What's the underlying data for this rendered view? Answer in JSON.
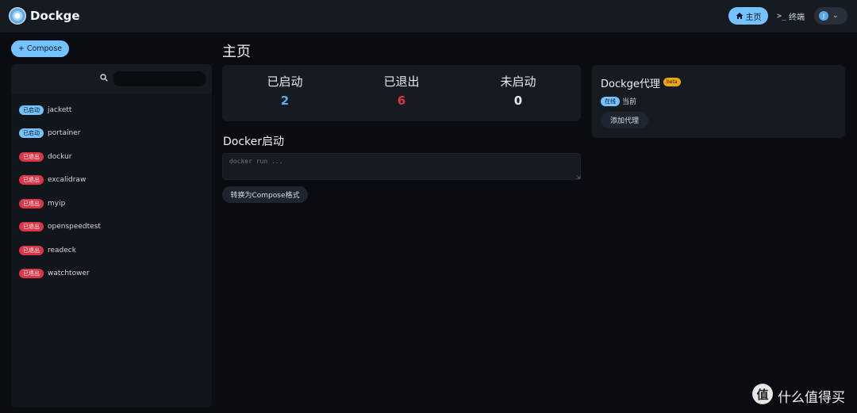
{
  "header": {
    "brand": "Dockge",
    "nav_home": "主页",
    "nav_terminal": "终端",
    "avatar_initial": "J"
  },
  "sidebar": {
    "compose_label": "Compose",
    "search_value": "",
    "stacks": [
      {
        "status": "已启动",
        "state": "running",
        "name": "jackett"
      },
      {
        "status": "已启动",
        "state": "running",
        "name": "portainer"
      },
      {
        "status": "已退出",
        "state": "exited",
        "name": "dockur"
      },
      {
        "status": "已退出",
        "state": "exited",
        "name": "excalidraw"
      },
      {
        "status": "已退出",
        "state": "exited",
        "name": "myip"
      },
      {
        "status": "已退出",
        "state": "exited",
        "name": "openspeedtest"
      },
      {
        "status": "已退出",
        "state": "exited",
        "name": "readeck"
      },
      {
        "status": "已退出",
        "state": "exited",
        "name": "watchtower"
      }
    ]
  },
  "main": {
    "title": "主页",
    "stats": [
      {
        "label": "已启动",
        "value": "2",
        "color": "#5aaaf0"
      },
      {
        "label": "已退出",
        "value": "6",
        "color": "#dc3545"
      },
      {
        "label": "未启动",
        "value": "0",
        "color": "#e6e9ed"
      }
    ],
    "docker_run_title": "Docker启动",
    "docker_run_placeholder": "docker run ...",
    "convert_label": "转换为Compose格式"
  },
  "proxy": {
    "title": "Dockge代理",
    "beta": "beta",
    "online_badge": "在线",
    "online_text": "当前",
    "add_label": "添加代理"
  },
  "watermark": {
    "logo_glyph": "值",
    "text": "什么值得买"
  },
  "colors": {
    "accent": "#74c2ff",
    "exited": "#dc3545",
    "beta": "#f0a60a",
    "background": "#090c10",
    "card": "#161b22"
  }
}
